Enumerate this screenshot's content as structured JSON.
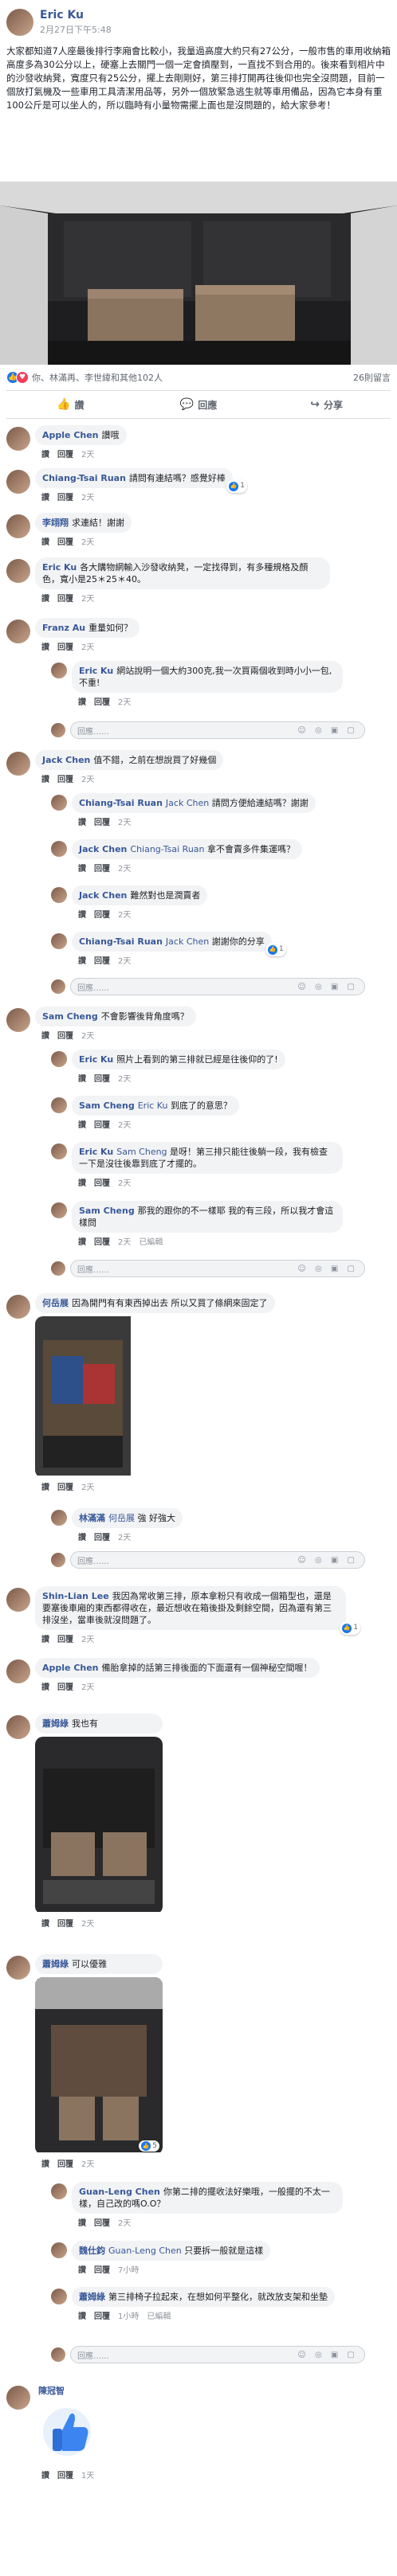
{
  "post": {
    "author": "Eric Ku",
    "time": "2月27日下午5:48",
    "text": "大家都知道7人座最後排行李廂會比較小，我量過高度大約只有27公分，一般市售的車用收納箱高度多為30公分以上，硬塞上去關門一個一定會擠壓到，一直找不到合用的。後來看到相片中的沙發收納凳，寬度只有25公分，擺上去剛剛好，第三排打開再往後仰也完全沒問題，目前一個放打氣機及一些車用工具清潔用品等，另外一個放緊急逃生就等車用備品，因為它本身有重100公斤是可以坐人的，所以臨時有小量物需擺上面也是沒問題的，給大家參考！"
  },
  "reactions": {
    "summary": "你、林滿再、李世緯和其他102人",
    "comments_count": "26則留言"
  },
  "actions": {
    "like": "讚",
    "comment": "回應",
    "share": "分享"
  },
  "comment_placeholder": "回應……",
  "input_icons": "☺ ◎ ▣ ▢",
  "comments": [
    {
      "name": "Apple Chen",
      "text": "讚哦",
      "like": "讚",
      "reply": "回覆",
      "time": "2天"
    },
    {
      "name": "Chiang-Tsai Ruan",
      "text": "請問有連結嗎？感覺好棒",
      "like": "讚",
      "reply": "回覆",
      "time": "2天",
      "badge": "1"
    },
    {
      "name": "李翊翔",
      "text": "求連結！謝謝",
      "like": "讚",
      "reply": "回覆",
      "time": "2天"
    },
    {
      "name": "Eric Ku",
      "text": "各大購物網輸入沙發收納凳，一定找得到，有多種規格及顏色，寬小是25＊25＊40。",
      "like": "讚",
      "reply": "回覆",
      "time": "2天"
    },
    {
      "name": "Franz Au",
      "text": "重量如何？",
      "like": "讚",
      "reply": "回覆",
      "time": "2天"
    },
    {
      "name": "Eric Ku",
      "text": "網站說明一個大約300克,我一次買兩個收到時小小一包,不重!",
      "like": "讚",
      "reply": "回覆",
      "time": "2天"
    },
    {
      "name": "Jack Chen",
      "text": "值不錯，之前在想說買了好幾個",
      "like": "讚",
      "reply": "回覆",
      "time": "2天"
    },
    {
      "name": "Chiang-Tsai Ruan",
      "mention": "Jack Chen",
      "text": "請問方便給連結嗎？謝謝",
      "like": "讚",
      "reply": "回覆",
      "time": "2天"
    },
    {
      "name": "Jack Chen",
      "mention": "Chiang-Tsai Ruan",
      "text": "拿不會賣多件集運嗎？",
      "like": "讚",
      "reply": "回覆",
      "time": "2天"
    },
    {
      "name": "Jack Chen",
      "text": "難然對也是潤賣者",
      "like": "讚",
      "reply": "回覆",
      "time": "2天"
    },
    {
      "name": "Chiang-Tsai Ruan",
      "mention": "Jack Chen",
      "text": "謝謝你的分享",
      "like": "讚",
      "reply": "回覆",
      "time": "2天",
      "badge": "1"
    },
    {
      "name": "Sam Cheng",
      "text": "不會影響後背角度嗎？",
      "like": "讚",
      "reply": "回覆",
      "time": "2天"
    },
    {
      "name": "Eric Ku",
      "text": "照片上看到的第三排就已經是往後仰的了!",
      "like": "讚",
      "reply": "回覆",
      "time": "2天"
    },
    {
      "name": "Sam Cheng",
      "mention": "Eric Ku",
      "text": "到底了的意思？",
      "like": "讚",
      "reply": "回覆",
      "time": "2天"
    },
    {
      "name": "Eric Ku",
      "mention": "Sam Cheng",
      "text": "是呀！第三排只能往後躺一段，我有檢查一下是沒往後靠到底了才擺的。",
      "like": "讚",
      "reply": "回覆",
      "time": "2天"
    },
    {
      "name": "Sam Cheng",
      "text": "那我的跟你的不一樣耶 我的有三段，所以我才會這樣問",
      "like": "讚",
      "reply": "回覆",
      "time": "2天",
      "edited": "已編輯"
    },
    {
      "name": "何岳展",
      "text": "因為開門有有東西掉出去 所以又買了條網來固定了",
      "like": "讚",
      "reply": "回覆",
      "time": "2天"
    },
    {
      "name": "林滿滿",
      "mention": "何岳展",
      "text": "強 好強大",
      "like": "讚",
      "reply": "回覆",
      "time": "2天"
    },
    {
      "name": "Shin-Lian Lee",
      "text": "我因為常收第三排，原本拿粉只有收成一個箱型也，還是要塞後車廂的東西都得收在，最近想收在箱後掛及剩餘空間，因為還有第三排沒坐，當車後就沒問題了。",
      "like": "讚",
      "reply": "回覆",
      "time": "2天",
      "badge": "1"
    },
    {
      "name": "Apple Chen",
      "text": "備胎拿掉的話第三排後面的下面還有一個神秘空間喔！",
      "like": "讚",
      "reply": "回覆",
      "time": "2天"
    },
    {
      "name": "蕭姆綠",
      "text": "我也有",
      "like": "讚",
      "reply": "回覆",
      "time": "2天"
    },
    {
      "name": "蕭姆綠",
      "text": "可以優雅",
      "like": "讚",
      "reply": "回覆",
      "time": "2天",
      "badge": "5"
    },
    {
      "name": "Guan-Leng Chen",
      "text": "你第二排的擺收法好樂哦，一般擺的不太一樣，自己改的嗎O.O？",
      "like": "讚",
      "reply": "回覆",
      "time": "2天"
    },
    {
      "name": "魏仕鈞",
      "mention": "Guan-Leng Chen",
      "text": "只要拆一般就是這樣",
      "like": "讚",
      "reply": "回覆",
      "time": "7小時"
    },
    {
      "name": "蕭姆綠",
      "text": "第三排椅子拉起來，在想如何平整化，就改放支架和坐墊",
      "like": "讚",
      "reply": "回覆",
      "time": "1小時",
      "edited": "已編輯"
    },
    {
      "name": "陳冠智",
      "text": "",
      "like": "讚",
      "reply": "回覆",
      "time": "1天"
    }
  ]
}
